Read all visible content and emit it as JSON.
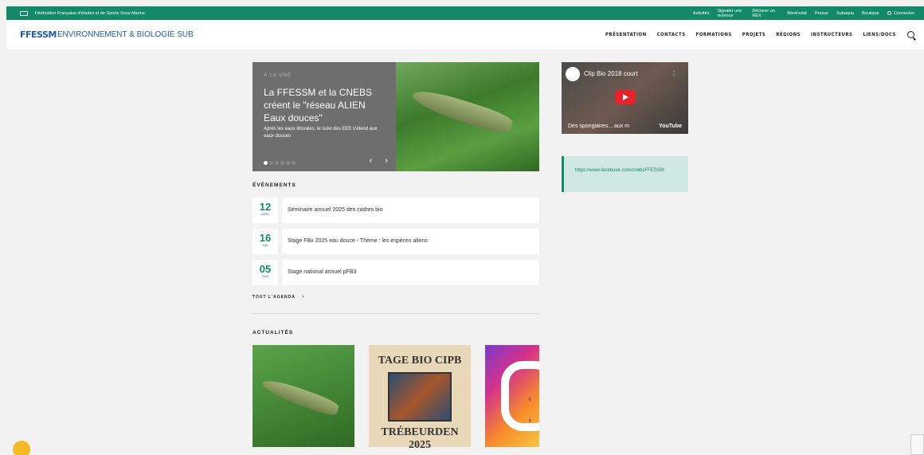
{
  "topbar": {
    "org": "Fédération Française d'études et de Sports Sous-Marins",
    "links": [
      "Activités",
      "Signaler une violence",
      "Déclarer un REX",
      "Bénévolat",
      "Presse",
      "Subaqua",
      "Boutique"
    ],
    "login": "Connexion"
  },
  "brand": {
    "part1": "FFESSM",
    "part2": "ENVIRONNEMENT & BIOLOGIE SUB"
  },
  "nav": [
    "PRÉSENTATION",
    "CONTACTS",
    "FORMATIONS",
    "PROJETS",
    "RÉGIONS",
    "INSTRUCTEURS",
    "LIENS/DOCS"
  ],
  "hero": {
    "kicker": "À LA UNE",
    "title": "La FFESSM et la CNEBS créent le \"réseau ALIEN Eaux douces\"",
    "subtitle": "Après les eaux littorales, le suivi des EEE s'étend aux eaux douces",
    "prev": "‹",
    "next": "›"
  },
  "events": {
    "title": "ÉVÉNEMENTS",
    "items": [
      {
        "day": "12",
        "month": "AVRIL",
        "label": "Séminaire annuel 2025 des cadres bio"
      },
      {
        "day": "16",
        "month": "MAI",
        "label": "Stage FBx 2025 eau douce - Thème : les espèces aliens"
      },
      {
        "day": "05",
        "month": "JUIN",
        "label": "Stage national annuel pFB3"
      }
    ],
    "agenda": "TOUT L'AGENDA"
  },
  "news": {
    "title": "ACTUALITÉS",
    "card2_line1": "TAGE BIO CIPB",
    "card2_line2": "TRÉBEURDEN 2025"
  },
  "video": {
    "title": "Clip Bio 2018 court",
    "caption": "Des spongiaires... aux m",
    "platform": "YouTube"
  },
  "facebook": {
    "url": "https://www.facebook.com/cnebsFFESSM"
  }
}
